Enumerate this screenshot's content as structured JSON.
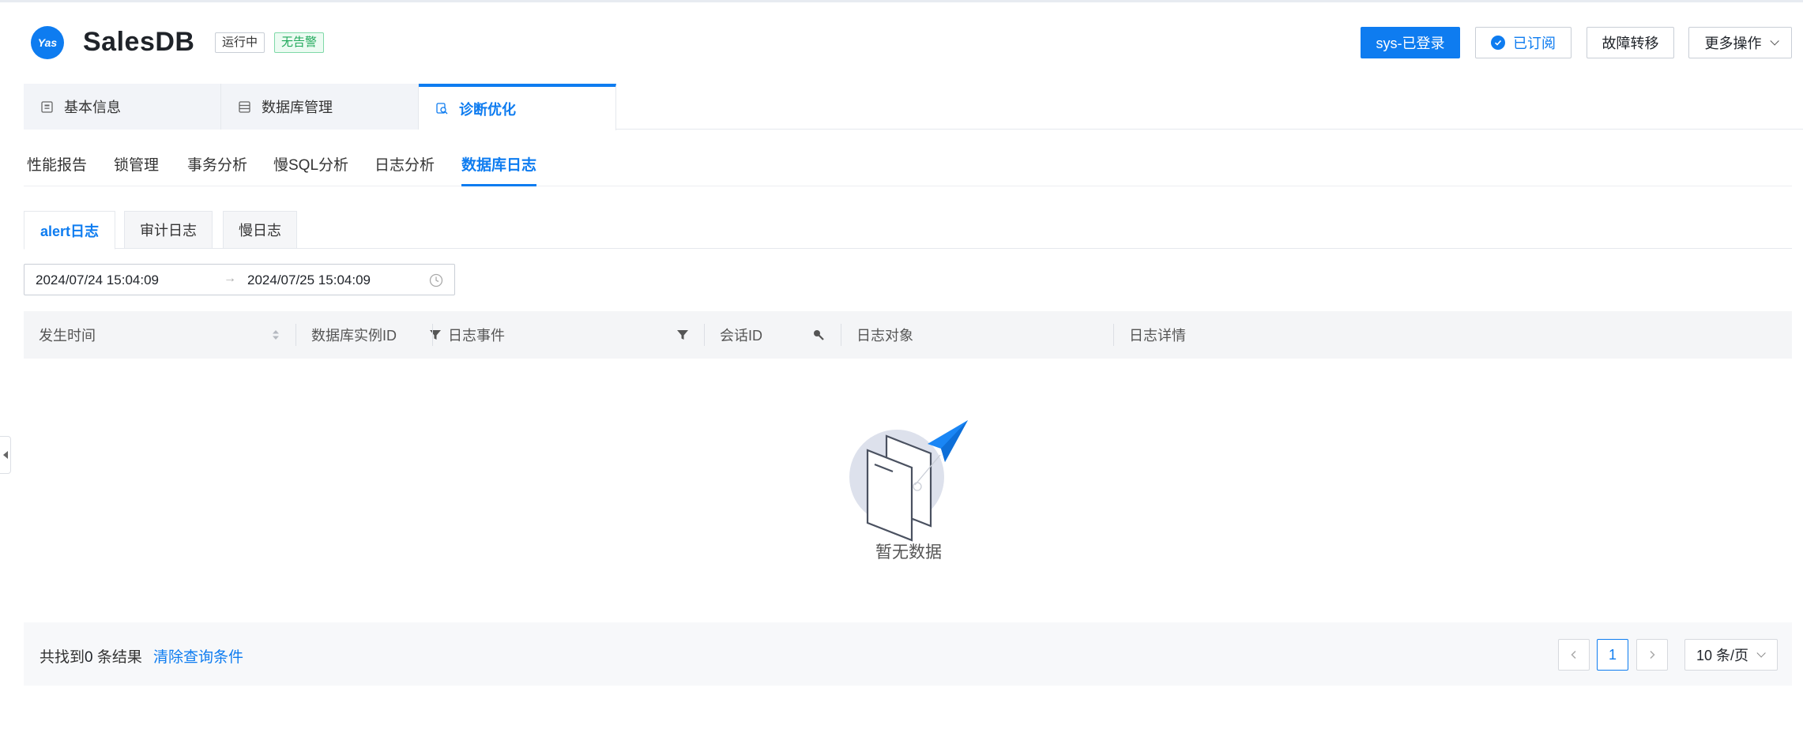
{
  "header": {
    "logo_text": "Yas",
    "title": "SalesDB",
    "status_badge": "运行中",
    "alarm_badge": "无告警",
    "buttons": {
      "login": "sys-已登录",
      "subscribed": "已订阅",
      "failover": "故障转移",
      "more": "更多操作"
    }
  },
  "main_tabs": [
    {
      "label": "基本信息",
      "icon": "info-card-icon"
    },
    {
      "label": "数据库管理",
      "icon": "database-list-icon"
    },
    {
      "label": "诊断优化",
      "icon": "diagnose-search-icon",
      "active": true
    }
  ],
  "sub_tabs": [
    {
      "label": "性能报告"
    },
    {
      "label": "锁管理"
    },
    {
      "label": "事务分析"
    },
    {
      "label": "慢SQL分析"
    },
    {
      "label": "日志分析"
    },
    {
      "label": "数据库日志",
      "active": true
    }
  ],
  "log_tabs": [
    {
      "label": "alert日志",
      "active": true
    },
    {
      "label": "审计日志"
    },
    {
      "label": "慢日志"
    }
  ],
  "date_range": {
    "start": "2024/07/24 15:04:09",
    "separator": "→",
    "end": "2024/07/25 15:04:09"
  },
  "table": {
    "columns": [
      {
        "label": "发生时间",
        "control": "sort-icon"
      },
      {
        "label": "数据库实例ID",
        "control": "filter-icon"
      },
      {
        "label": "日志事件",
        "control": "filter-icon"
      },
      {
        "label": "会话ID",
        "control": "search-icon"
      },
      {
        "label": "日志对象"
      },
      {
        "label": "日志详情"
      }
    ],
    "rows": [],
    "empty_text": "暂无数据"
  },
  "footer": {
    "total_prefix": "共找到",
    "total_count": "0",
    "total_suffix": "条结果",
    "clear_label": "清除查询条件",
    "current_page": "1",
    "page_size": "10 条/页"
  },
  "colors": {
    "accent": "#0e7cf0",
    "success": "#1fa85a"
  }
}
